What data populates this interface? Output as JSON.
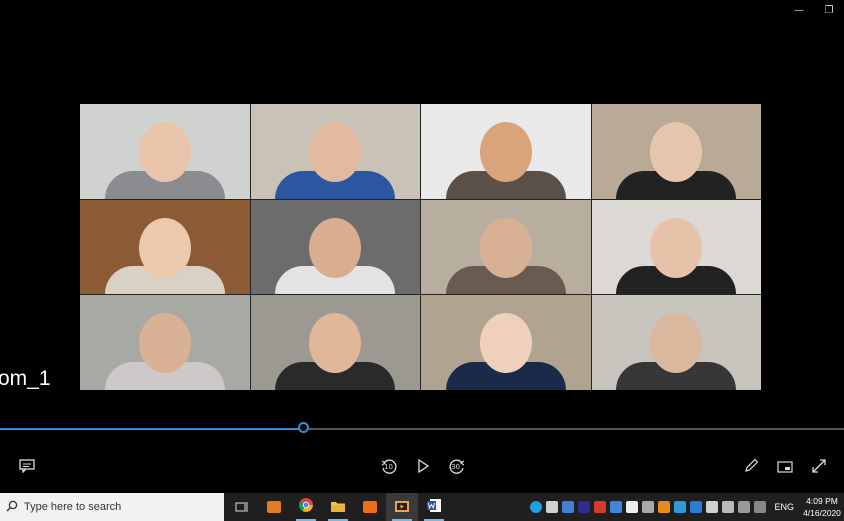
{
  "window": {
    "minimize_glyph": "—",
    "restore_glyph": "❐"
  },
  "player": {
    "title_overlay": "om_1",
    "progress_fraction": 0.36,
    "controls": {
      "skip_back_label": "10",
      "skip_forward_label": "30"
    }
  },
  "participants": [
    {
      "bg": "#cfd2cf",
      "skin": "#e8c4aa",
      "shirt": "#8a8c90"
    },
    {
      "bg": "#c9c2b6",
      "skin": "#e2b9a0",
      "shirt": "#2c56a0"
    },
    {
      "bg": "#e9e9ea",
      "skin": "#d9a37c",
      "shirt": "#5a5048"
    },
    {
      "bg": "#b9aa98",
      "skin": "#e6c7ae",
      "shirt": "#222"
    },
    {
      "bg": "#8d5a36",
      "skin": "#ecc9ad",
      "shirt": "#d9d0c6"
    },
    {
      "bg": "#6d6c6c",
      "skin": "#d9ae90",
      "shirt": "#e3e3e3"
    },
    {
      "bg": "#b8ae9f",
      "skin": "#d8b094",
      "shirt": "#6a5b50"
    },
    {
      "bg": "#dcd8d4",
      "skin": "#e6c3a8",
      "shirt": "#222"
    },
    {
      "bg": "#a9a9a4",
      "skin": "#d9b296",
      "shirt": "#cfc8c8"
    },
    {
      "bg": "#9c9892",
      "skin": "#e0b799",
      "shirt": "#2a2a2a"
    },
    {
      "bg": "#b0a490",
      "skin": "#efd0bb",
      "shirt": "#1b2a48"
    },
    {
      "bg": "#c8c4be",
      "skin": "#d9b89e",
      "shirt": "#363636"
    }
  ],
  "taskbar": {
    "search_placeholder": "Type here to search",
    "lang": "ENG",
    "time": "4:09 PM",
    "date": "4/16/2020"
  },
  "colors": {
    "accent": "#2f8fd8",
    "taskbar_bg": "#1f1f1f"
  }
}
